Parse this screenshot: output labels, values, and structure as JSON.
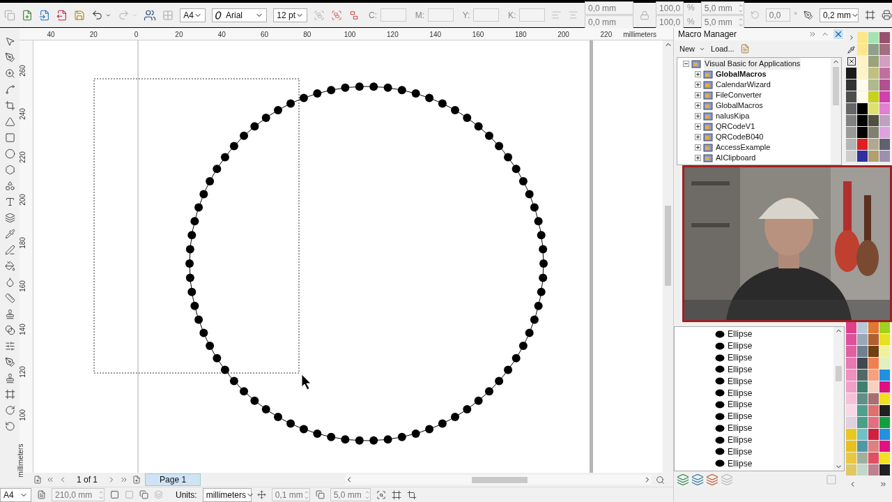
{
  "toolbar": {
    "page_size": "A4",
    "font": "Arial",
    "font_size": "12 pt",
    "color_labels": [
      "C:",
      "M:",
      "Y:",
      "K:"
    ],
    "position": [
      "0,0 mm",
      "0,0 mm"
    ],
    "scale": [
      "100,0",
      "100,0"
    ],
    "scale_units": [
      "%",
      "%"
    ],
    "nudge": [
      "5,0 mm",
      "5,0 mm"
    ],
    "rotation": "0,0",
    "rotation_unit": "°",
    "outline_width": "0,2 mm"
  },
  "ruler": {
    "horizontal": [
      "40",
      "20",
      "0",
      "20",
      "40",
      "60",
      "80",
      "100",
      "120",
      "140",
      "160",
      "180",
      "200",
      "220"
    ],
    "horizontal_unit": "millimeters",
    "vertical": [
      "260",
      "240",
      "220",
      "200",
      "180",
      "160",
      "140",
      "120",
      "100"
    ],
    "vertical_unit": "millimeters"
  },
  "macro_manager": {
    "title": "Macro Manager",
    "new": "New",
    "load": "Load...",
    "tree": {
      "label": "Visual Basic for Applications",
      "expanded": true,
      "children": [
        {
          "label": "GlobalMacros",
          "active": true,
          "expanded": false
        },
        {
          "label": "CalendarWizard",
          "active": false,
          "expanded": false
        },
        {
          "label": "FileConverter",
          "active": false,
          "expanded": false
        },
        {
          "label": "GlobalMacros",
          "active": false,
          "expanded": false
        },
        {
          "label": "nalusKipa",
          "active": false,
          "expanded": false
        },
        {
          "label": "QRCodeV1",
          "active": false,
          "expanded": false
        },
        {
          "label": "QRCodeB040",
          "active": false,
          "expanded": false
        },
        {
          "label": "AccessExample",
          "active": false,
          "expanded": false
        },
        {
          "label": "AIClipboard",
          "active": false,
          "expanded": false
        }
      ]
    }
  },
  "object_manager": {
    "items": [
      "Ellipse",
      "Ellipse",
      "Ellipse",
      "Ellipse",
      "Ellipse",
      "Ellipse",
      "Ellipse",
      "Ellipse",
      "Ellipse",
      "Ellipse",
      "Ellipse",
      "Ellipse"
    ]
  },
  "page_nav": {
    "count": "1 of 1",
    "tabs": [
      {
        "label": "Page 1",
        "selected": true
      }
    ]
  },
  "status_bar": {
    "page_size": "A4",
    "width": "210,0 mm",
    "units_label": "Units:",
    "units": "millimeters",
    "nudge": "0,1 mm",
    "duplicate": "5,0 mm"
  },
  "palette": {
    "top": [
      [
        {
          "color": "#1a1a1a"
        },
        {
          "color": "#333333"
        },
        {
          "color": "#4d4d4d"
        },
        {
          "color": "#666666"
        },
        {
          "color": "#808080"
        },
        {
          "color": "#999999"
        },
        {
          "color": "#b3b3b3"
        },
        {
          "color": "#cccccc"
        }
      ],
      [
        {
          "color": "#fde68a"
        },
        {
          "color": "#fde68b"
        },
        {
          "color": "#fef3c7"
        },
        {
          "color": "#fef3c8"
        },
        {
          "color": "#fffbeb"
        },
        {
          "color": "#fffbec"
        },
        {
          "color": "#000000"
        },
        {
          "color": "#010101"
        },
        {
          "color": "#020202"
        },
        {
          "color": "#e02020"
        },
        {
          "color": "#3030a0"
        }
      ],
      [
        {
          "color": "#a7e3b0"
        },
        {
          "color": "#8fa08a"
        },
        {
          "color": "#9aa37a"
        },
        {
          "color": "#c0c080"
        },
        {
          "color": "#b0b890"
        },
        {
          "color": "#c8d020"
        },
        {
          "color": "#e0e070"
        },
        {
          "color": "#505040"
        },
        {
          "color": "#808070"
        },
        {
          "color": "#b0a890"
        },
        {
          "color": "#b0a070"
        }
      ],
      [
        {
          "color": "#9a5070"
        },
        {
          "color": "#a07080"
        },
        {
          "color": "#d0a0c0"
        },
        {
          "color": "#c070a0"
        },
        {
          "color": "#b05090"
        },
        {
          "color": "#d040b0"
        },
        {
          "color": "#e080d0"
        },
        {
          "color": "#c0a0c0"
        },
        {
          "color": "#e0a0e0"
        },
        {
          "color": "#606070"
        },
        {
          "color": "#a090b0"
        }
      ]
    ],
    "bottom": [
      [
        {
          "color": "#e0408a"
        },
        {
          "color": "#e0509a"
        },
        {
          "color": "#e060a0"
        },
        {
          "color": "#e878b0"
        },
        {
          "color": "#f090c0"
        },
        {
          "color": "#f0a0c8"
        },
        {
          "color": "#f8c0d8"
        },
        {
          "color": "#f8d8e8"
        },
        {
          "color": "#e0d0e0"
        },
        {
          "color": "#e8c820"
        },
        {
          "color": "#e8c020"
        },
        {
          "color": "#e8c840"
        },
        {
          "color": "#e0c860"
        }
      ],
      [
        {
          "color": "#b8c8d8"
        },
        {
          "color": "#98a8b8"
        },
        {
          "color": "#708090"
        },
        {
          "color": "#404850"
        },
        {
          "color": "#506868"
        },
        {
          "color": "#408070"
        },
        {
          "color": "#609088"
        },
        {
          "color": "#50a090"
        },
        {
          "color": "#48a088"
        },
        {
          "color": "#70c0c8"
        },
        {
          "color": "#5098a8"
        },
        {
          "color": "#a0b0a0"
        },
        {
          "color": "#c0d8c8"
        }
      ],
      [
        {
          "color": "#e07830"
        },
        {
          "color": "#b06030"
        },
        {
          "color": "#704010"
        },
        {
          "color": "#f08050"
        },
        {
          "color": "#f8a080"
        },
        {
          "color": "#f8d0c0"
        },
        {
          "color": "#a87070"
        },
        {
          "color": "#e07070"
        },
        {
          "color": "#e07080"
        },
        {
          "color": "#d02040"
        },
        {
          "color": "#e08080"
        },
        {
          "color": "#e05060"
        },
        {
          "color": "#c08090"
        }
      ],
      [
        {
          "color": "#a0d020"
        },
        {
          "color": "#e8e020"
        },
        {
          "color": "#f0f0a0"
        },
        {
          "color": "#e0f0c0"
        },
        {
          "color": "#2090e0"
        },
        {
          "color": "#e01080"
        },
        {
          "color": "#f0e020"
        },
        {
          "color": "#202020"
        },
        {
          "color": "#10a040"
        },
        {
          "color": "#2191e1"
        },
        {
          "color": "#e11181"
        },
        {
          "color": "#f1e121"
        },
        {
          "color": "#212121"
        }
      ]
    ]
  }
}
